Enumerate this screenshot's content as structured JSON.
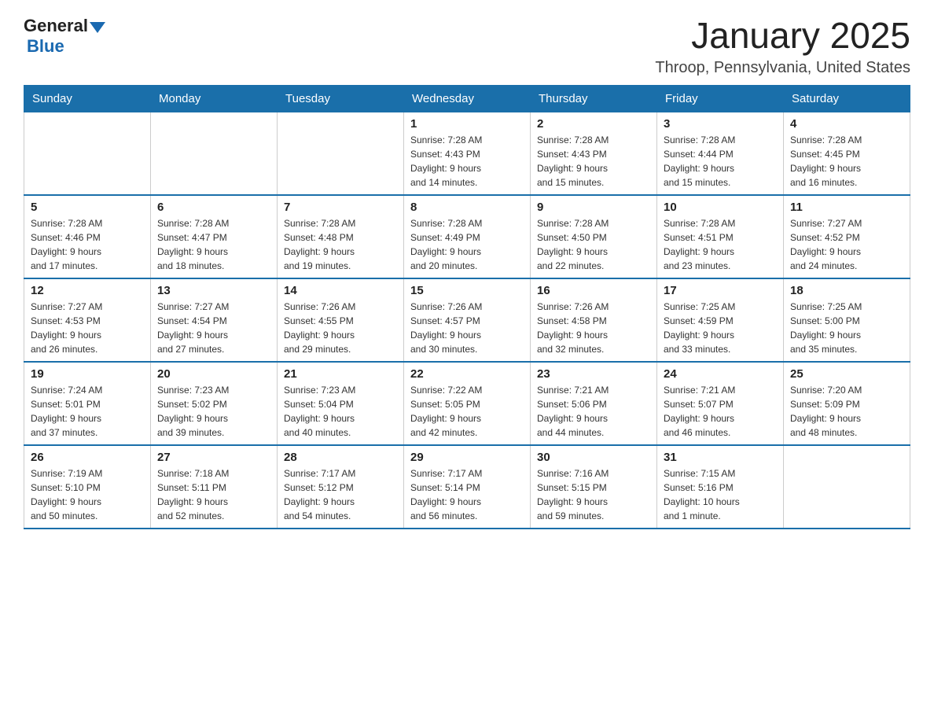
{
  "header": {
    "logo_general": "General",
    "logo_blue": "Blue",
    "month_title": "January 2025",
    "location": "Throop, Pennsylvania, United States"
  },
  "days_of_week": [
    "Sunday",
    "Monday",
    "Tuesday",
    "Wednesday",
    "Thursday",
    "Friday",
    "Saturday"
  ],
  "weeks": [
    [
      {
        "day": "",
        "info": ""
      },
      {
        "day": "",
        "info": ""
      },
      {
        "day": "",
        "info": ""
      },
      {
        "day": "1",
        "info": "Sunrise: 7:28 AM\nSunset: 4:43 PM\nDaylight: 9 hours\nand 14 minutes."
      },
      {
        "day": "2",
        "info": "Sunrise: 7:28 AM\nSunset: 4:43 PM\nDaylight: 9 hours\nand 15 minutes."
      },
      {
        "day": "3",
        "info": "Sunrise: 7:28 AM\nSunset: 4:44 PM\nDaylight: 9 hours\nand 15 minutes."
      },
      {
        "day": "4",
        "info": "Sunrise: 7:28 AM\nSunset: 4:45 PM\nDaylight: 9 hours\nand 16 minutes."
      }
    ],
    [
      {
        "day": "5",
        "info": "Sunrise: 7:28 AM\nSunset: 4:46 PM\nDaylight: 9 hours\nand 17 minutes."
      },
      {
        "day": "6",
        "info": "Sunrise: 7:28 AM\nSunset: 4:47 PM\nDaylight: 9 hours\nand 18 minutes."
      },
      {
        "day": "7",
        "info": "Sunrise: 7:28 AM\nSunset: 4:48 PM\nDaylight: 9 hours\nand 19 minutes."
      },
      {
        "day": "8",
        "info": "Sunrise: 7:28 AM\nSunset: 4:49 PM\nDaylight: 9 hours\nand 20 minutes."
      },
      {
        "day": "9",
        "info": "Sunrise: 7:28 AM\nSunset: 4:50 PM\nDaylight: 9 hours\nand 22 minutes."
      },
      {
        "day": "10",
        "info": "Sunrise: 7:28 AM\nSunset: 4:51 PM\nDaylight: 9 hours\nand 23 minutes."
      },
      {
        "day": "11",
        "info": "Sunrise: 7:27 AM\nSunset: 4:52 PM\nDaylight: 9 hours\nand 24 minutes."
      }
    ],
    [
      {
        "day": "12",
        "info": "Sunrise: 7:27 AM\nSunset: 4:53 PM\nDaylight: 9 hours\nand 26 minutes."
      },
      {
        "day": "13",
        "info": "Sunrise: 7:27 AM\nSunset: 4:54 PM\nDaylight: 9 hours\nand 27 minutes."
      },
      {
        "day": "14",
        "info": "Sunrise: 7:26 AM\nSunset: 4:55 PM\nDaylight: 9 hours\nand 29 minutes."
      },
      {
        "day": "15",
        "info": "Sunrise: 7:26 AM\nSunset: 4:57 PM\nDaylight: 9 hours\nand 30 minutes."
      },
      {
        "day": "16",
        "info": "Sunrise: 7:26 AM\nSunset: 4:58 PM\nDaylight: 9 hours\nand 32 minutes."
      },
      {
        "day": "17",
        "info": "Sunrise: 7:25 AM\nSunset: 4:59 PM\nDaylight: 9 hours\nand 33 minutes."
      },
      {
        "day": "18",
        "info": "Sunrise: 7:25 AM\nSunset: 5:00 PM\nDaylight: 9 hours\nand 35 minutes."
      }
    ],
    [
      {
        "day": "19",
        "info": "Sunrise: 7:24 AM\nSunset: 5:01 PM\nDaylight: 9 hours\nand 37 minutes."
      },
      {
        "day": "20",
        "info": "Sunrise: 7:23 AM\nSunset: 5:02 PM\nDaylight: 9 hours\nand 39 minutes."
      },
      {
        "day": "21",
        "info": "Sunrise: 7:23 AM\nSunset: 5:04 PM\nDaylight: 9 hours\nand 40 minutes."
      },
      {
        "day": "22",
        "info": "Sunrise: 7:22 AM\nSunset: 5:05 PM\nDaylight: 9 hours\nand 42 minutes."
      },
      {
        "day": "23",
        "info": "Sunrise: 7:21 AM\nSunset: 5:06 PM\nDaylight: 9 hours\nand 44 minutes."
      },
      {
        "day": "24",
        "info": "Sunrise: 7:21 AM\nSunset: 5:07 PM\nDaylight: 9 hours\nand 46 minutes."
      },
      {
        "day": "25",
        "info": "Sunrise: 7:20 AM\nSunset: 5:09 PM\nDaylight: 9 hours\nand 48 minutes."
      }
    ],
    [
      {
        "day": "26",
        "info": "Sunrise: 7:19 AM\nSunset: 5:10 PM\nDaylight: 9 hours\nand 50 minutes."
      },
      {
        "day": "27",
        "info": "Sunrise: 7:18 AM\nSunset: 5:11 PM\nDaylight: 9 hours\nand 52 minutes."
      },
      {
        "day": "28",
        "info": "Sunrise: 7:17 AM\nSunset: 5:12 PM\nDaylight: 9 hours\nand 54 minutes."
      },
      {
        "day": "29",
        "info": "Sunrise: 7:17 AM\nSunset: 5:14 PM\nDaylight: 9 hours\nand 56 minutes."
      },
      {
        "day": "30",
        "info": "Sunrise: 7:16 AM\nSunset: 5:15 PM\nDaylight: 9 hours\nand 59 minutes."
      },
      {
        "day": "31",
        "info": "Sunrise: 7:15 AM\nSunset: 5:16 PM\nDaylight: 10 hours\nand 1 minute."
      },
      {
        "day": "",
        "info": ""
      }
    ]
  ]
}
